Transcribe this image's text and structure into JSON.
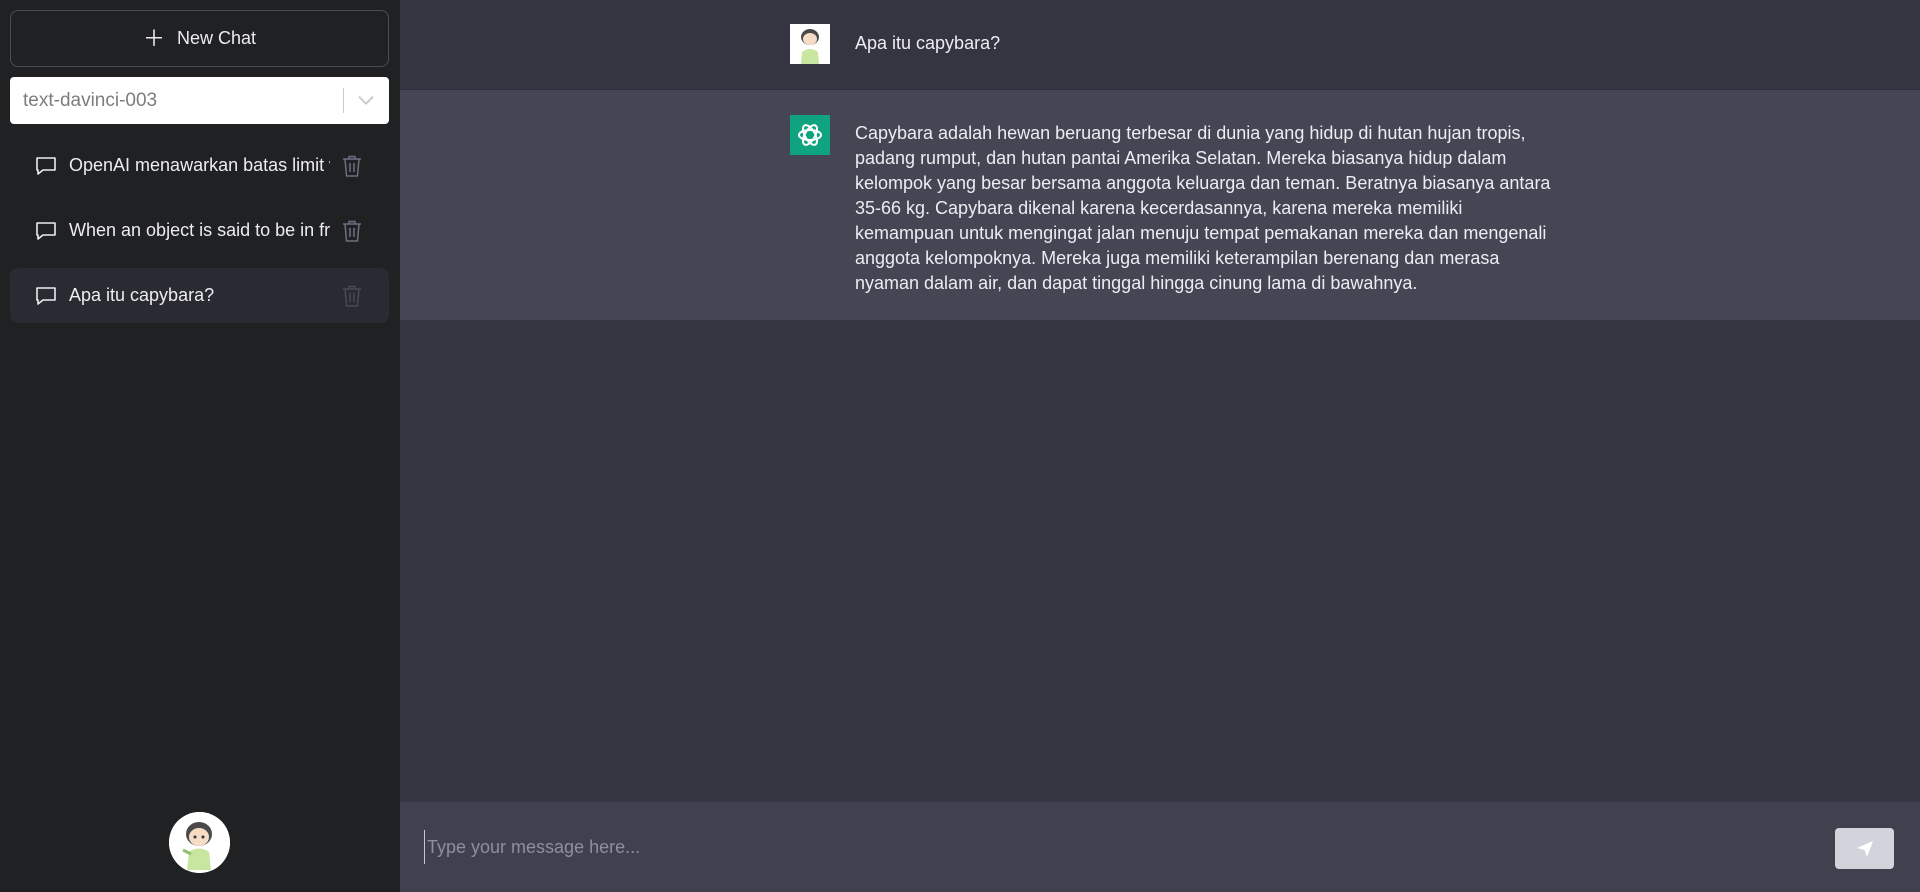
{
  "sidebar": {
    "new_chat_label": "New Chat",
    "model": {
      "selected": "text-davinci-003"
    },
    "conversations": [
      {
        "title": "OpenAI menawarkan batas limit w"
      },
      {
        "title": "When an object is said to be in fre"
      },
      {
        "title": "Apa itu capybara?"
      }
    ]
  },
  "chat": {
    "messages": [
      {
        "role": "user",
        "text": "Apa itu capybara?"
      },
      {
        "role": "assistant",
        "text": "Capybara adalah hewan beruang terbesar di dunia yang hidup di hutan hujan tropis, padang rumput, dan hutan pantai Amerika Selatan. Mereka biasanya hidup dalam kelompok yang besar bersama anggota keluarga dan teman. Beratnya biasanya antara 35-66 kg. Capybara dikenal karena kecerdasannya, karena mereka memiliki kemampuan untuk mengingat jalan menuju tempat pemakanan mereka dan mengenali anggota kelompoknya. Mereka juga memiliki keterampilan berenang dan merasa nyaman dalam air, dan dapat tinggal hingga cinung lama di bawahnya."
      }
    ]
  },
  "input": {
    "placeholder": "Type your message here...",
    "value": ""
  },
  "colors": {
    "sidebar_bg": "#202123",
    "main_bg": "#343541",
    "assistant_bg": "#444654",
    "input_bg": "#40414f",
    "brand_green": "#10a37f"
  },
  "icons": {
    "new_chat": "plus-icon",
    "select": "chevron-down-icon",
    "conversation": "chat-bubble-icon",
    "delete": "trash-icon",
    "assistant": "openai-logo-icon",
    "send": "paper-plane-icon"
  }
}
